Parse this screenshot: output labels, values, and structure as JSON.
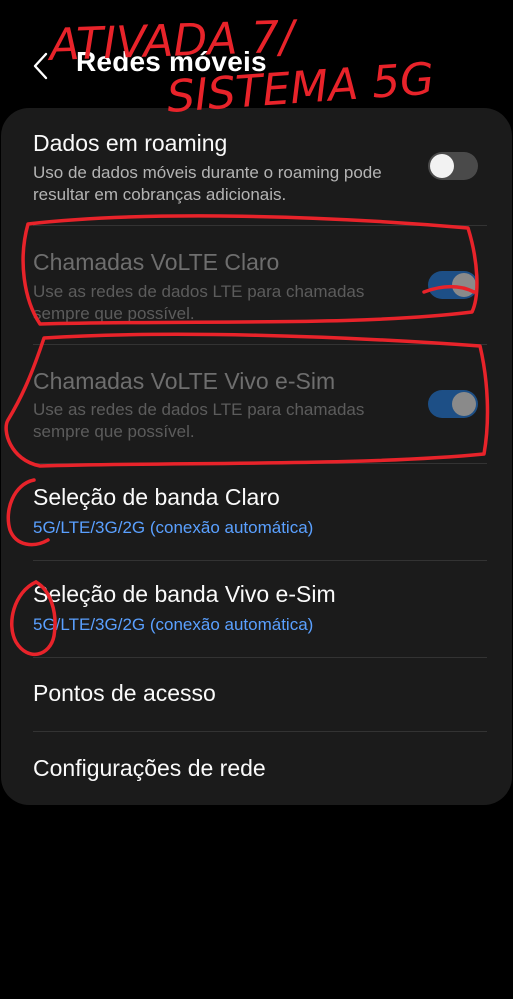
{
  "header": {
    "title": "Redes móveis",
    "back_icon": "chevron-left-icon"
  },
  "settings": {
    "roaming": {
      "title": "Dados em roaming",
      "subtitle": "Uso de dados móveis durante o roaming pode resultar em cobranças adicionais.",
      "enabled": false
    },
    "volte_claro": {
      "title": "Chamadas VoLTE Claro",
      "subtitle": "Use as redes de dados LTE para chamadas sempre que possível.",
      "enabled": true
    },
    "volte_vivo": {
      "title": "Chamadas VoLTE Vivo e-Sim",
      "subtitle": "Use as redes de dados LTE para chamadas sempre que possível.",
      "enabled": true
    },
    "band_claro": {
      "title": "Seleção de banda Claro",
      "value": "5G/LTE/3G/2G (conexão automática)"
    },
    "band_vivo": {
      "title": "Seleção de banda Vivo e-Sim",
      "value": "5G/LTE/3G/2G (conexão automática)"
    },
    "access_points": {
      "title": "Pontos de acesso"
    },
    "network_config": {
      "title": "Configurações de rede"
    }
  },
  "annotation": {
    "line1": "ATIVADA 7/",
    "line2": "SISTEMA 5G"
  },
  "colors": {
    "background": "#000000",
    "card": "#1b1b1b",
    "accent_blue": "#5aa0ff",
    "annotation_red": "#e8232a"
  }
}
